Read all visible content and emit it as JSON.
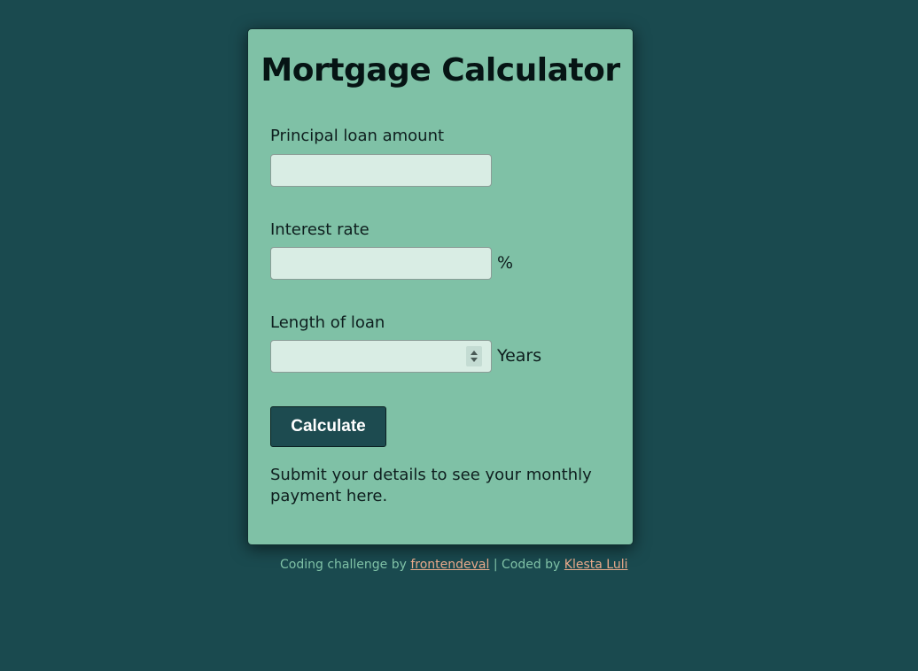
{
  "card": {
    "title": "Mortgage Calculator",
    "principal": {
      "label": "Principal loan amount",
      "value": "",
      "placeholder": ""
    },
    "interest": {
      "label": "Interest rate",
      "value": "",
      "placeholder": "",
      "suffix": "%"
    },
    "length": {
      "label": "Length of loan",
      "value": "",
      "placeholder": "",
      "suffix": "Years",
      "spinner_icon": "spinner-arrows-icon"
    },
    "calculate_label": "Calculate",
    "result_text": "Submit your details to see your monthly payment here."
  },
  "footer": {
    "prefix": "Coding challenge by ",
    "challenge_link": "frontendeval",
    "separator": " | Coded by ",
    "author_link": "Klesta Luli"
  },
  "colors": {
    "background": "#1a4a4f",
    "card": "#7fc1a6",
    "input": "#d9ede4",
    "button": "#1d4b50",
    "link": "#e8a98a"
  }
}
